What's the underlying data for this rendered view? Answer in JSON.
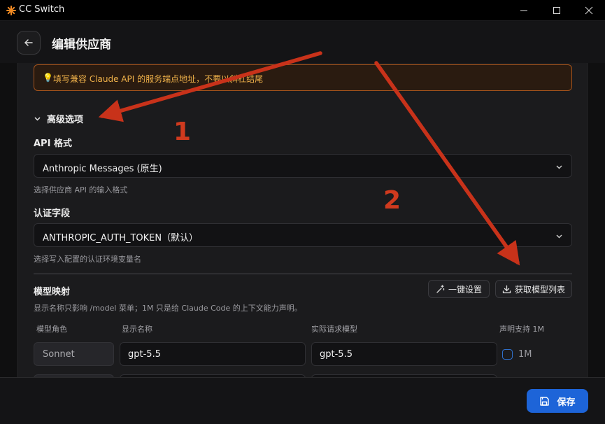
{
  "window": {
    "title": "CC Switch"
  },
  "header": {
    "title": "编辑供应商"
  },
  "tip": {
    "text": "填写兼容 Claude API 的服务端点地址，不要以斜杠结尾"
  },
  "advanced": {
    "label": "高级选项"
  },
  "api_format": {
    "label": "API 格式",
    "value": "Anthropic Messages (原生)",
    "hint": "选择供应商 API 的输入格式"
  },
  "auth_field": {
    "label": "认证字段",
    "value": "ANTHROPIC_AUTH_TOKEN（默认）",
    "hint": "选择写入配置的认证环境变量名"
  },
  "model_mapping": {
    "title": "模型映射",
    "one_click_label": "一键设置",
    "fetch_label": "获取模型列表",
    "description": "显示名称只影响 /model 菜单；1M 只是给 Claude Code 的上下文能力声明。",
    "columns": [
      "模型角色",
      "显示名称",
      "实际请求模型",
      "声明支持 1M"
    ],
    "rows": [
      {
        "role": "Sonnet",
        "display_name": "gpt-5.5",
        "request_model": "gpt-5.5",
        "one_m_label": "1M",
        "one_m_checked": false
      },
      {
        "role": "",
        "display_name": "",
        "request_model": "",
        "one_m_label": "",
        "one_m_checked": false
      }
    ]
  },
  "footer": {
    "save_label": "保存"
  },
  "annotations": {
    "marker_1": "1",
    "marker_2": "2",
    "arrow_color": "#c8321a"
  },
  "colors": {
    "accent": "#1d64d8",
    "warning": "#f0b24a"
  }
}
